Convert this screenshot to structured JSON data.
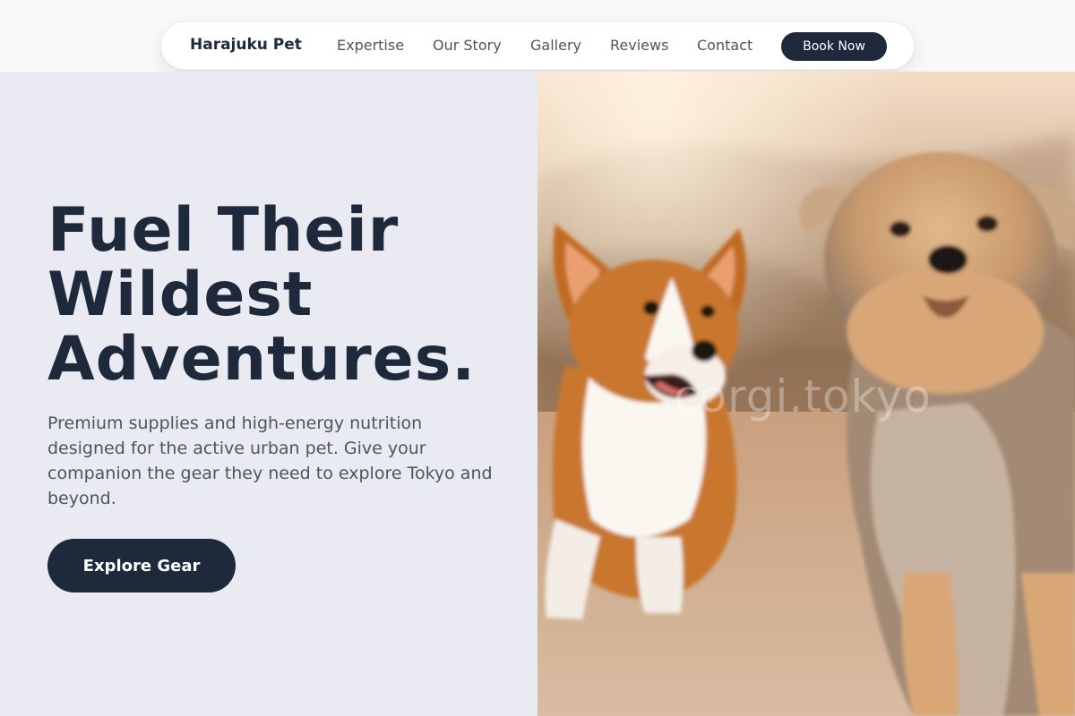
{
  "nav": {
    "brand": "Harajuku Pet",
    "links": [
      "Expertise",
      "Our Story",
      "Gallery",
      "Reviews",
      "Contact"
    ],
    "cta_label": "Book Now"
  },
  "hero": {
    "headline_lines": [
      "Fuel Their",
      "Wildest",
      "Adventures."
    ],
    "subtext": "Premium supplies and high-energy nutrition designed for the active urban pet. Give your companion the gear they need to explore Tokyo and beyond.",
    "cta_label": "Explore Gear",
    "image_watermark": "corgi.tokyo"
  },
  "colors": {
    "primary_dark": "#1e293b",
    "panel_bg": "#e9eaf2",
    "body_text": "#4b5563"
  }
}
